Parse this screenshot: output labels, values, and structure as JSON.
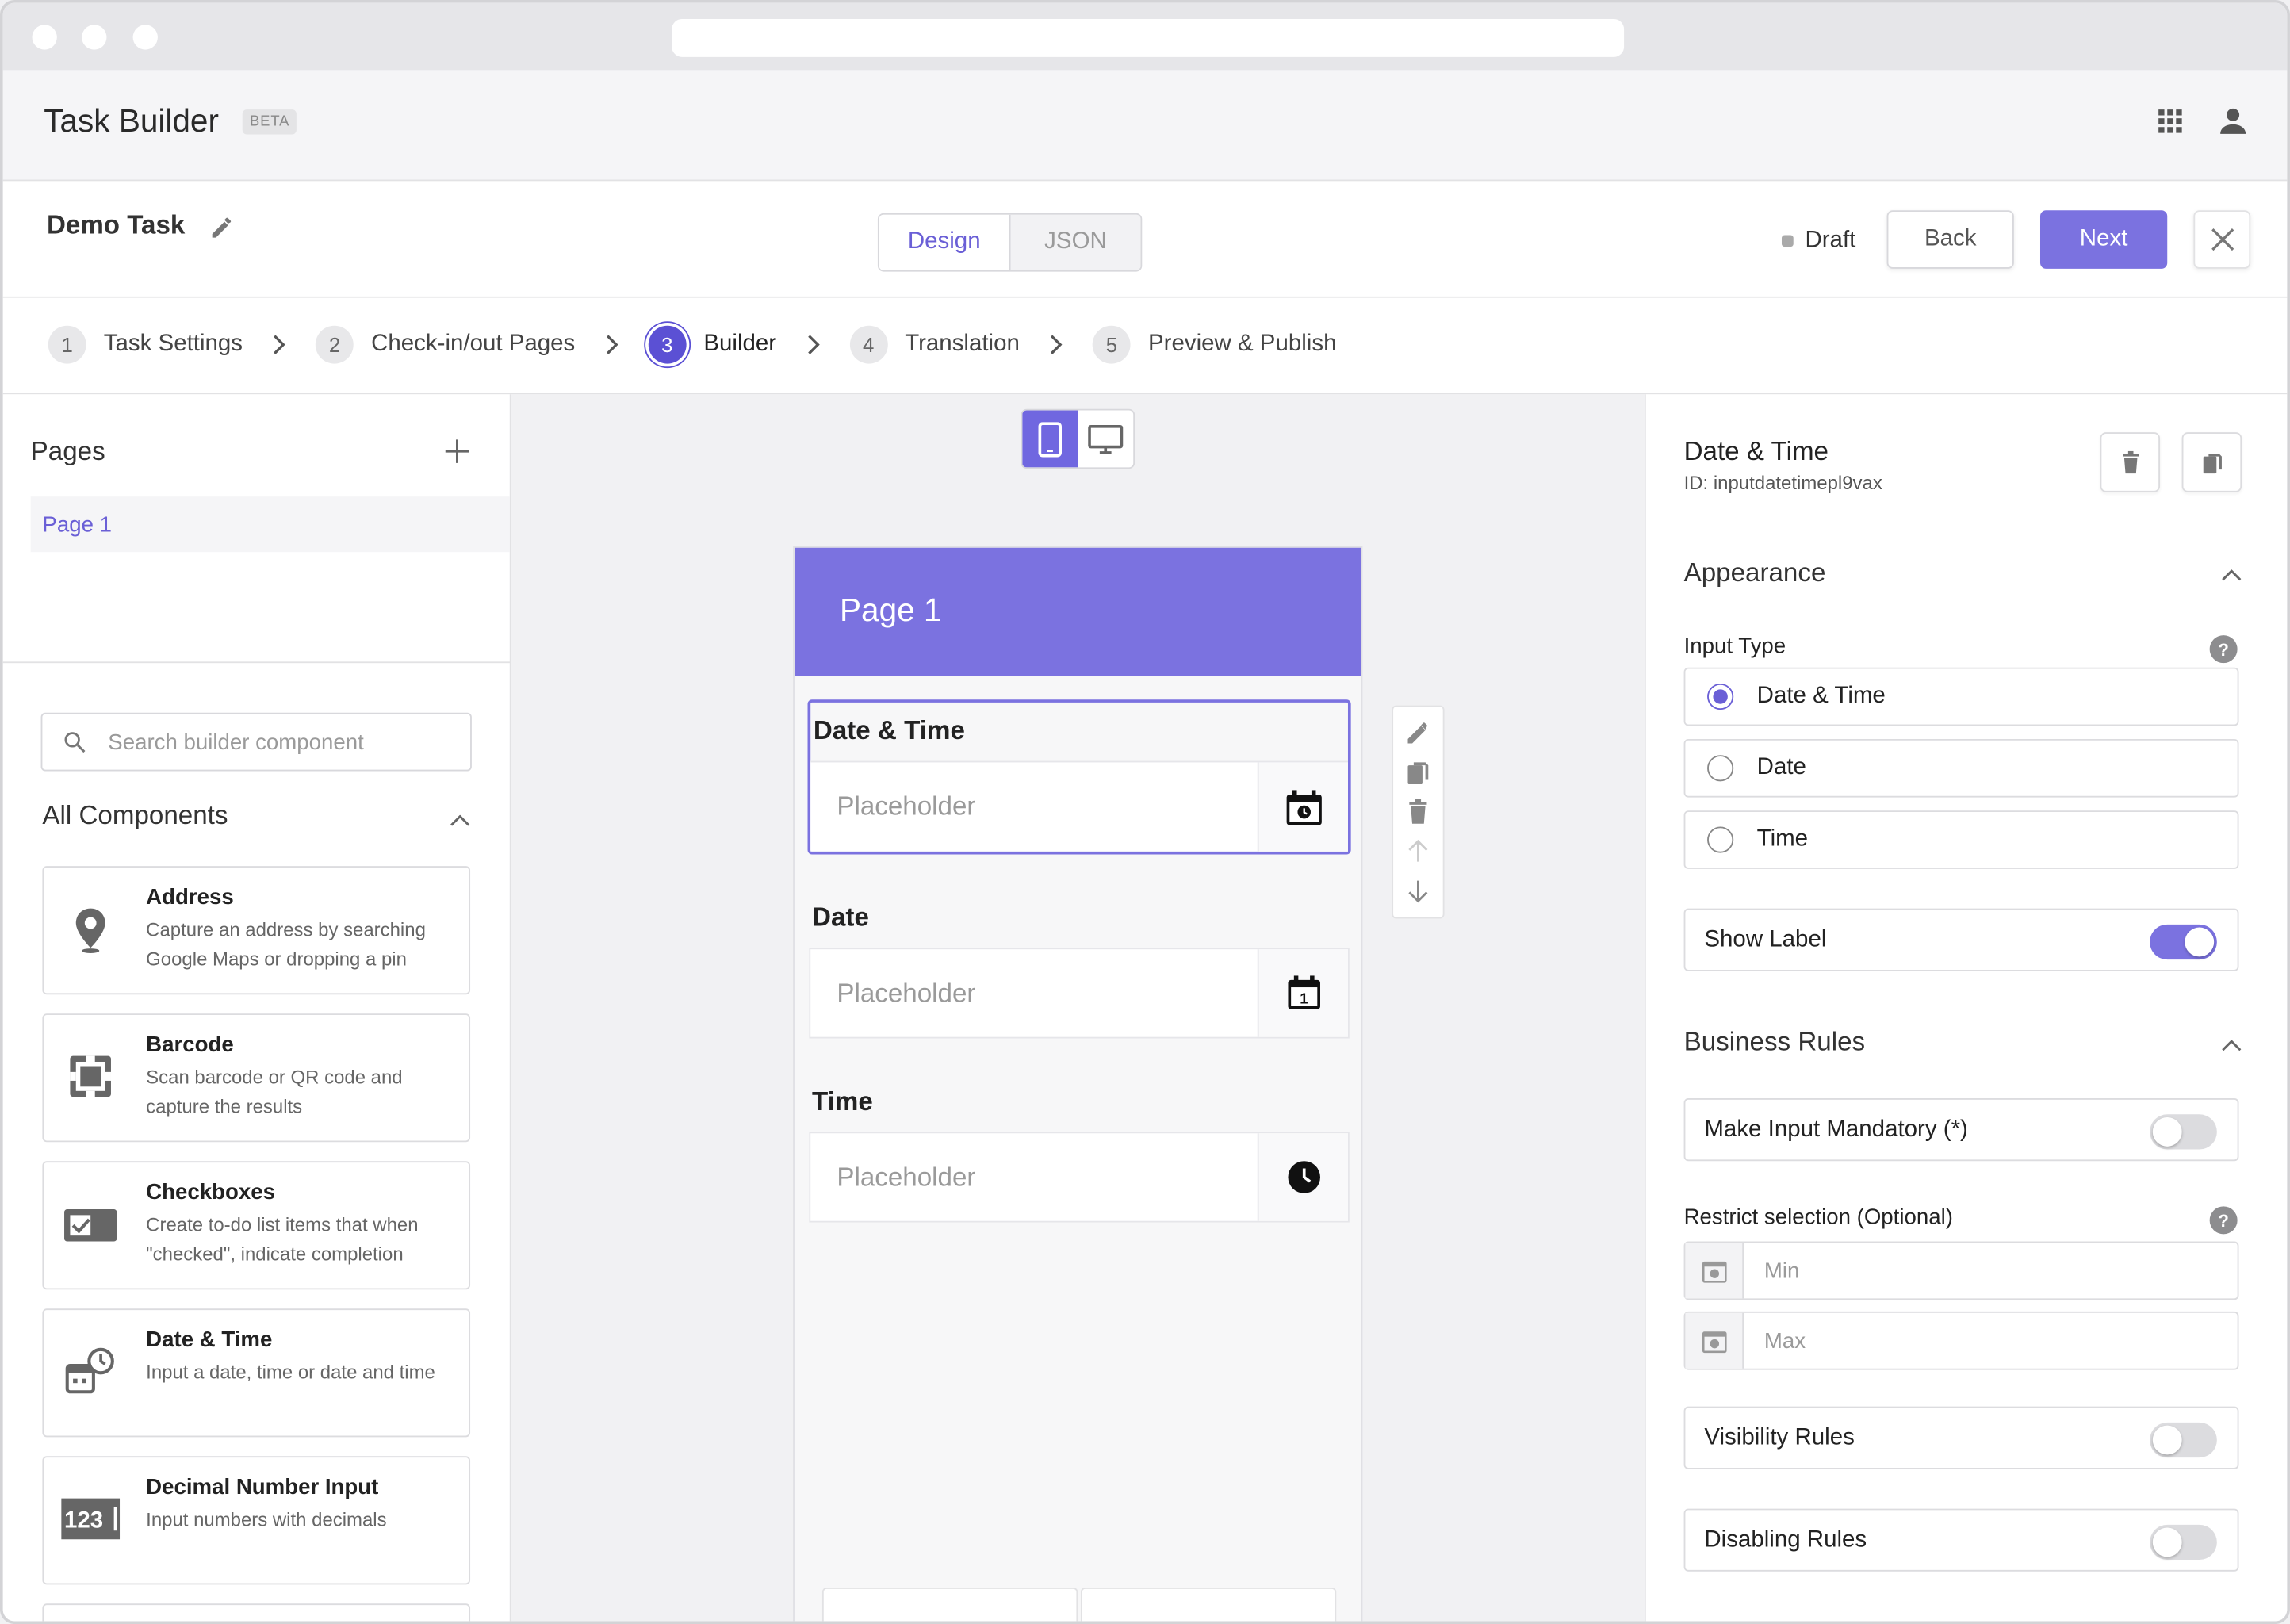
{
  "app": {
    "title": "Task Builder",
    "badge": "BETA"
  },
  "task": {
    "name": "Demo Task",
    "status": "Draft"
  },
  "view_tabs": [
    "Design",
    "JSON"
  ],
  "actions": {
    "back": "Back",
    "next": "Next"
  },
  "steps": [
    {
      "num": "1",
      "label": "Task Settings"
    },
    {
      "num": "2",
      "label": "Check-in/out Pages"
    },
    {
      "num": "3",
      "label": "Builder",
      "active": true
    },
    {
      "num": "4",
      "label": "Translation"
    },
    {
      "num": "5",
      "label": "Preview & Publish"
    }
  ],
  "pages_panel": {
    "title": "Pages",
    "items": [
      "Page 1"
    ]
  },
  "components": {
    "search_placeholder": "Search builder component",
    "section_title": "All Components",
    "items": [
      {
        "title": "Address",
        "desc": "Capture an address by searching Google Maps or dropping a pin",
        "icon": "location-pin-icon"
      },
      {
        "title": "Barcode",
        "desc": "Scan barcode or QR code and capture the results",
        "icon": "barcode-scan-icon"
      },
      {
        "title": "Checkboxes",
        "desc": "Create to-do list items that when \"checked\", indicate completion",
        "icon": "checkbox-icon"
      },
      {
        "title": "Date & Time",
        "desc": "Input a date, time or date and time",
        "icon": "calendar-clock-icon"
      },
      {
        "title": "Decimal Number Input",
        "desc": "Input numbers with decimals",
        "icon": "decimal-number-icon"
      }
    ]
  },
  "canvas": {
    "page_title": "Page 1",
    "fields": [
      {
        "label": "Date & Time",
        "placeholder": "Placeholder",
        "icon": "calendar-clock-icon"
      },
      {
        "label": "Date",
        "placeholder": "Placeholder",
        "icon": "calendar-icon"
      },
      {
        "label": "Time",
        "placeholder": "Placeholder",
        "icon": "clock-icon"
      }
    ]
  },
  "properties": {
    "title": "Date & Time",
    "id": "ID: inputdatetimepl9vax",
    "appearance": "Appearance",
    "input_type_label": "Input Type",
    "input_types": [
      "Date & Time",
      "Date",
      "Time"
    ],
    "selected_input_type": "Date & Time",
    "show_label": "Show Label",
    "show_label_on": true,
    "business_rules": "Business Rules",
    "mandatory": "Make Input Mandatory (*)",
    "mandatory_on": false,
    "restrict_label": "Restrict selection (Optional)",
    "min_placeholder": "Min",
    "max_placeholder": "Max",
    "visibility": "Visibility Rules",
    "visibility_on": false,
    "disabling": "Disabling Rules",
    "disabling_on": false
  },
  "colors": {
    "accent": "#7b72e0",
    "accent_dark": "#5b50d4"
  }
}
